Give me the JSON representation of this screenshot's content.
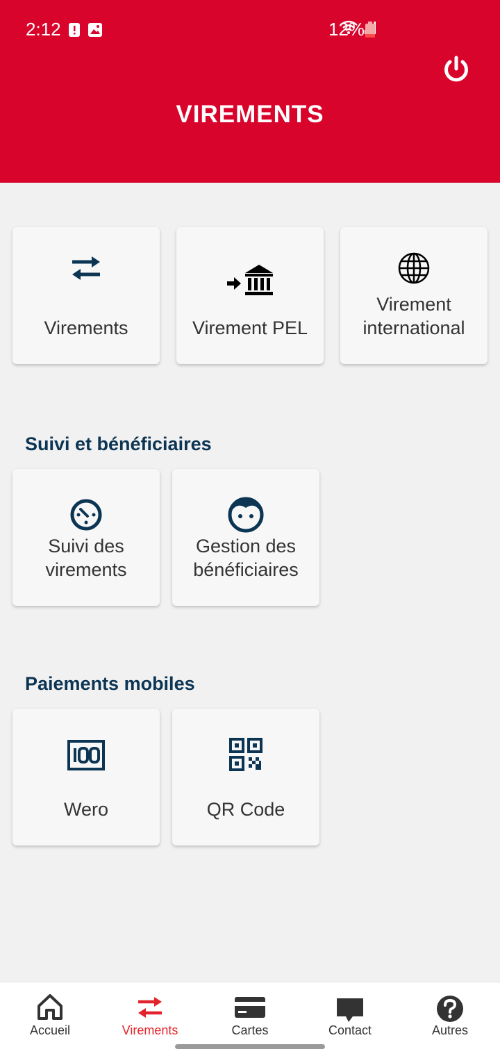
{
  "status_bar": {
    "time": "2:12",
    "battery": "12%"
  },
  "header": {
    "title": "VIREMENTS"
  },
  "top_cards": [
    {
      "label": "Virements",
      "icon": "arrows-transfer-icon"
    },
    {
      "label": "Virement PEL",
      "icon": "bank-arrow-icon"
    },
    {
      "label": "Virement international",
      "icon": "globe-icon"
    }
  ],
  "sections": {
    "suivi": {
      "title": "Suivi et bénéficiaires",
      "cards": [
        {
          "label": "Suivi des virements",
          "icon": "timer-icon"
        },
        {
          "label": "Gestion des bénéficiaires",
          "icon": "face-icon"
        }
      ]
    },
    "mobile": {
      "title": "Paiements mobiles",
      "cards": [
        {
          "label": "Wero",
          "icon": "wero-icon"
        },
        {
          "label": "QR Code",
          "icon": "qr-code-icon"
        }
      ]
    }
  },
  "bottom_nav": {
    "items": [
      {
        "label": "Accueil",
        "icon": "home-icon"
      },
      {
        "label": "Virements",
        "icon": "arrows-transfer-icon",
        "active": true
      },
      {
        "label": "Cartes",
        "icon": "card-icon"
      },
      {
        "label": "Contact",
        "icon": "chat-icon"
      },
      {
        "label": "Autres",
        "icon": "help-icon"
      }
    ]
  },
  "colors": {
    "brand_red": "#d9042b",
    "navy": "#0c3453",
    "active_nav": "#e3232b"
  }
}
